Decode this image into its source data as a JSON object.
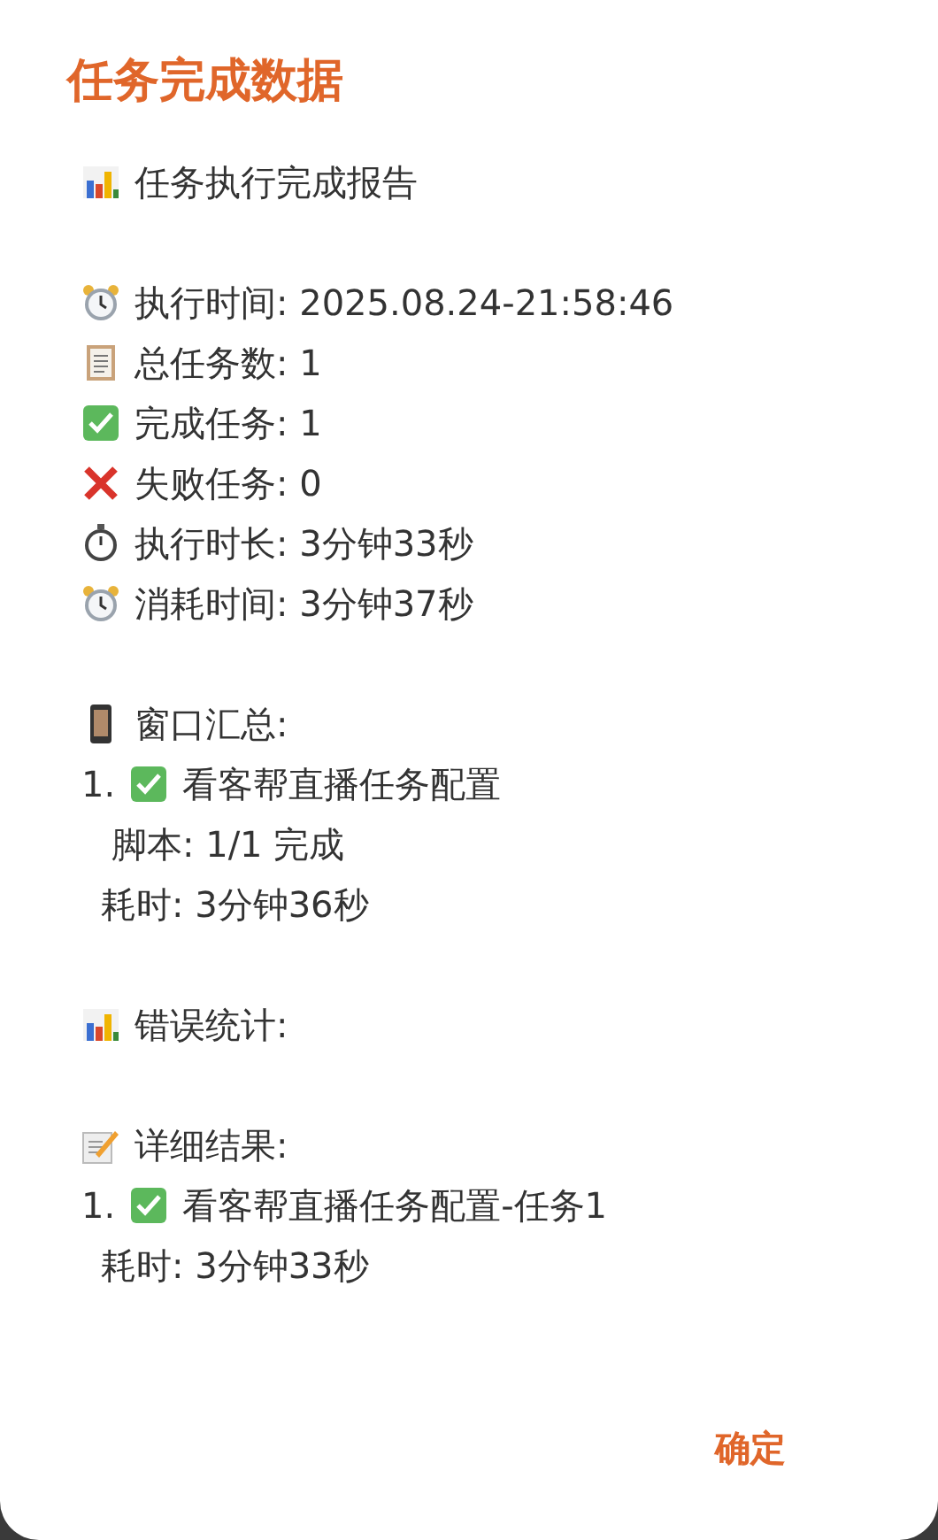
{
  "dialog": {
    "title": "任务完成数据",
    "report": {
      "heading": "任务执行完成报告",
      "stats": [
        "执行时间: 2025.08.24-21:58:46",
        "总任务数: 1",
        "完成任务: 1",
        "失败任务: 0",
        "执行时长: 3分钟33秒",
        "消耗时间: 3分钟37秒"
      ],
      "window_summary": {
        "heading": "窗口汇总:",
        "items": [
          {
            "number": "1.",
            "success": true,
            "name": "看客帮直播任务配置",
            "details": [
              "脚本: 1/1 完成",
              "耗时: 3分钟36秒"
            ]
          }
        ]
      },
      "error_stats": {
        "heading": "错误统计:"
      },
      "detailed_results": {
        "heading": "详细结果:",
        "items": [
          {
            "number": "1.",
            "success": true,
            "name": "看客帮直播任务配置-任务1",
            "details": [
              "耗时: 3分钟33秒"
            ]
          }
        ]
      }
    },
    "buttons": [
      "确定"
    ]
  }
}
